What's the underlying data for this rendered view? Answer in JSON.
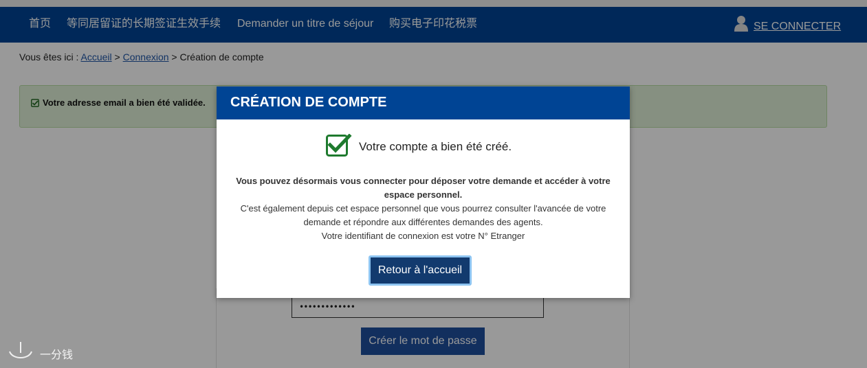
{
  "nav": {
    "items": [
      {
        "label": "首页"
      },
      {
        "label": "等同居留证的长期签证生效手续"
      },
      {
        "label": "Demander un titre de séjour"
      },
      {
        "label": "购买电子印花税票"
      }
    ],
    "login_label": "SE CONNECTER",
    "login_icon": "user-icon"
  },
  "breadcrumb": {
    "prefix": "Vous êtes ici : ",
    "links": [
      "Accueil",
      "Connexion"
    ],
    "sep": " > ",
    "current": "Création de compte"
  },
  "alert": {
    "icon": "check-square-icon",
    "text": "Votre adresse email a bien été validée."
  },
  "form": {
    "password_value": "•••••••••••••",
    "submit_label": "Créer le mot de passe"
  },
  "modal": {
    "title": "CRÉATION DE COMPTE",
    "success_icon": "check-box-icon",
    "success_text": "Votre compte a bien été créé.",
    "line1": "Vous pouvez désormais vous connecter pour déposer votre demande et accéder à votre espace personnel.",
    "line2": "C'est également depuis cet espace personnel que vous pourrez consulter l'avancée de votre demande et répondre aux différentes demandes des agents.",
    "line3": "Votre identifiant de connexion est votre N° Etranger",
    "button_label": "Retour à l'accueil"
  },
  "watermark": {
    "text": "一分钱"
  },
  "colors": {
    "brand_blue": "#004494",
    "button_dark": "#123a6e",
    "success_green": "#1e7a2e",
    "alert_bg": "#dff0d8"
  }
}
